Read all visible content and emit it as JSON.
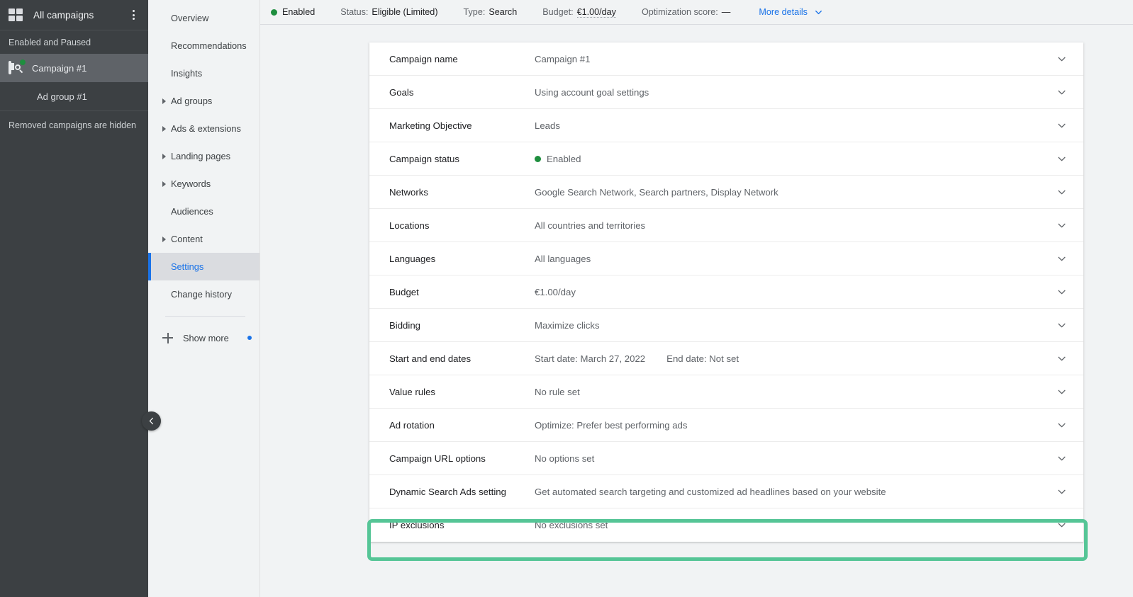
{
  "rail": {
    "grid_icon": "apps-grid-icon",
    "title": "All campaigns",
    "menu_icon": "more-vert-icon",
    "section_label": "Enabled and Paused",
    "campaign": {
      "label": "Campaign #1",
      "icon": "search-campaign-icon",
      "status_dot_color": "#1e8e3e"
    },
    "ad_group": {
      "label": "Ad group #1"
    },
    "footnote": "Removed campaigns are hidden",
    "collapse_icon": "chevron-left-icon"
  },
  "nav": {
    "items": [
      {
        "label": "Overview",
        "expandable": false,
        "selected": false
      },
      {
        "label": "Recommendations",
        "expandable": false,
        "selected": false
      },
      {
        "label": "Insights",
        "expandable": false,
        "selected": false
      },
      {
        "label": "Ad groups",
        "expandable": true,
        "selected": false
      },
      {
        "label": "Ads & extensions",
        "expandable": true,
        "selected": false
      },
      {
        "label": "Landing pages",
        "expandable": true,
        "selected": false
      },
      {
        "label": "Keywords",
        "expandable": true,
        "selected": false
      },
      {
        "label": "Audiences",
        "expandable": false,
        "selected": false
      },
      {
        "label": "Content",
        "expandable": true,
        "selected": false
      },
      {
        "label": "Settings",
        "expandable": false,
        "selected": true
      },
      {
        "label": "Change history",
        "expandable": false,
        "selected": false
      }
    ],
    "show_more": {
      "label": "Show more",
      "icon": "plus-icon",
      "badge_color": "#1a73e8"
    }
  },
  "topbar": {
    "state_label": "Enabled",
    "state_dot_color": "#1e8e3e",
    "status_key": "Status:",
    "status_value": "Eligible (Limited)",
    "type_key": "Type:",
    "type_value": "Search",
    "budget_key": "Budget:",
    "budget_value": "€1.00/day",
    "optimization_key": "Optimization score:",
    "optimization_value": "—",
    "more_details": "More details",
    "more_details_icon": "chevron-down-icon"
  },
  "settings": {
    "rows": [
      {
        "label": "Campaign name",
        "value": "Campaign #1",
        "status_dot": false,
        "highlighted": false
      },
      {
        "label": "Goals",
        "value": "Using account goal settings",
        "status_dot": false,
        "highlighted": false
      },
      {
        "label": "Marketing Objective",
        "value": "Leads",
        "status_dot": false,
        "highlighted": false
      },
      {
        "label": "Campaign status",
        "value": "Enabled",
        "status_dot": true,
        "highlighted": false
      },
      {
        "label": "Networks",
        "value": "Google Search Network, Search partners, Display Network",
        "status_dot": false,
        "highlighted": false
      },
      {
        "label": "Locations",
        "value": "All countries and territories",
        "status_dot": false,
        "highlighted": false
      },
      {
        "label": "Languages",
        "value": "All languages",
        "status_dot": false,
        "highlighted": false
      },
      {
        "label": "Budget",
        "value": "€1.00/day",
        "status_dot": false,
        "highlighted": false
      },
      {
        "label": "Bidding",
        "value": "Maximize clicks",
        "status_dot": false,
        "highlighted": false
      },
      {
        "label": "Start and end dates",
        "value": "Start date: March 27, 2022",
        "value2": "End date: Not set",
        "status_dot": false,
        "highlighted": false
      },
      {
        "label": "Value rules",
        "value": "No rule set",
        "status_dot": false,
        "highlighted": false
      },
      {
        "label": "Ad rotation",
        "value": "Optimize: Prefer best performing ads",
        "status_dot": false,
        "highlighted": false
      },
      {
        "label": "Campaign URL options",
        "value": "No options set",
        "status_dot": false,
        "highlighted": false
      },
      {
        "label": "Dynamic Search Ads setting",
        "value": "Get automated search targeting and customized ad headlines based on your website",
        "status_dot": false,
        "highlighted": false
      },
      {
        "label": "IP exclusions",
        "value": "No exclusions set",
        "status_dot": false,
        "highlighted": true
      }
    ],
    "expand_icon": "chevron-down-icon"
  },
  "colors": {
    "accent_blue": "#1a73e8",
    "status_green": "#1e8e3e",
    "highlight_green": "#55c596",
    "rail_dark": "#3c4043",
    "page_bg": "#f1f3f4"
  }
}
